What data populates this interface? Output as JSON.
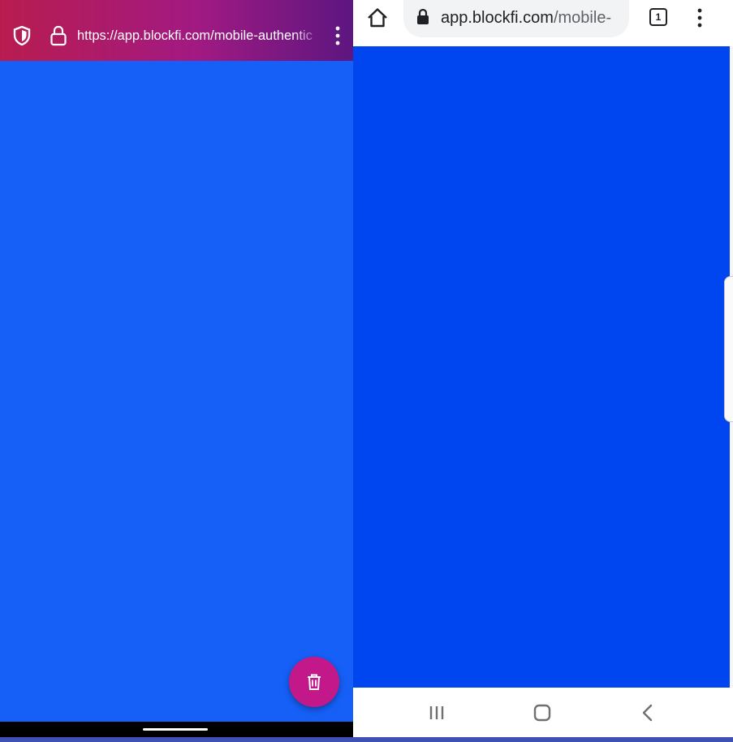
{
  "colors": {
    "left_page_background": "#1660f7",
    "right_page_background": "#0046f0",
    "firefox_toolbar_gradient": [
      "#b81c4f",
      "#a21a82",
      "#5d1680"
    ],
    "fab_color": "#c2188a"
  },
  "left_browser": {
    "url": "https://app.blockfi.com/mobile-authentic",
    "icons": {
      "tracking_protection": "shield-icon",
      "security": "lock-icon",
      "menu": "kebab-menu-icon",
      "fab": "trash-icon"
    }
  },
  "right_browser": {
    "url_host": "app.blockfi.com",
    "url_path": "/mobile-",
    "tab_count": "1",
    "icons": {
      "home": "home-icon",
      "security": "lock-icon",
      "menu": "kebab-menu-icon"
    },
    "nav_bar": {
      "recents": "recents-icon",
      "home": "home-icon",
      "back": "back-icon"
    }
  }
}
